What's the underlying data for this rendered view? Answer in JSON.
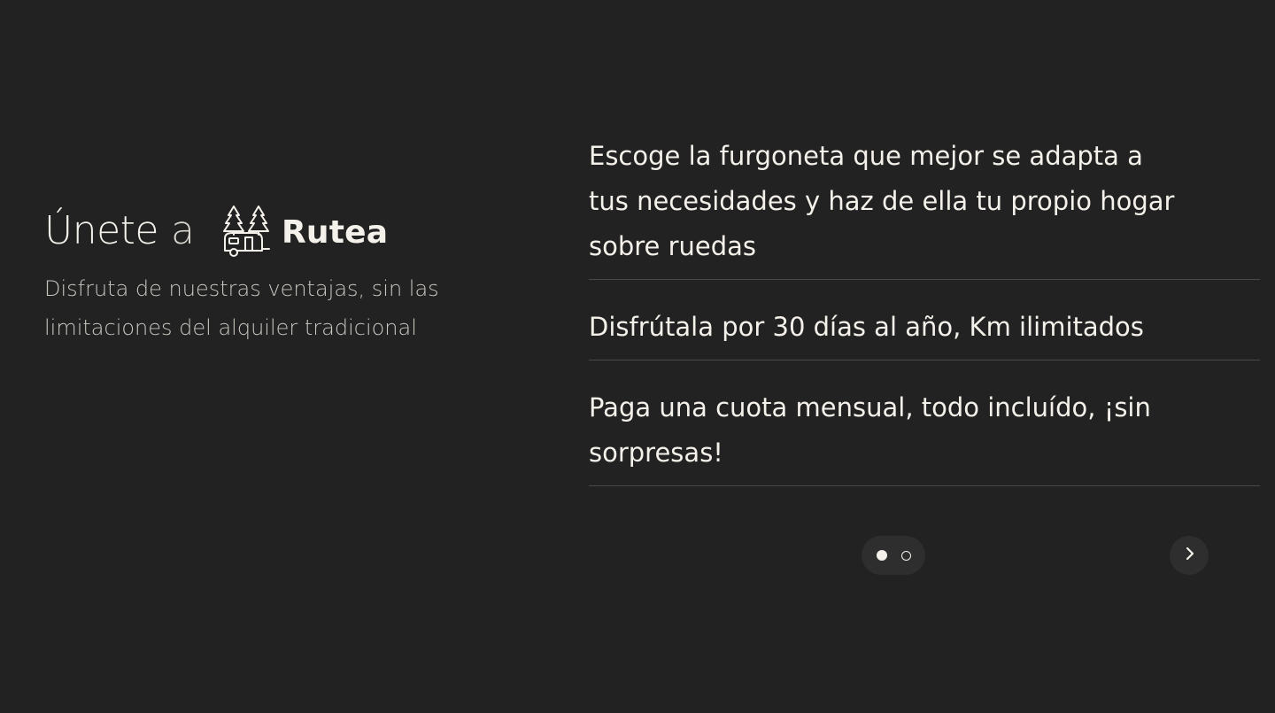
{
  "intro": {
    "heading": "Únete",
    "heading_connector": "a",
    "brand_name": "Rutea",
    "logo_icon": "trees-caravan-icon",
    "subtitle": "Disfruta de nuestras ventajas, sin las limitaciones del alquiler tradicional"
  },
  "benefits": [
    {
      "text": "Escoge la furgoneta que mejor se adapta a tus necesidades y haz de ella tu propio hogar sobre ruedas"
    },
    {
      "text": "Disfrútala por 30 días al año, Km ilimitados"
    },
    {
      "text": "Paga una cuota mensual, todo incluído, ¡sin sorpresas!"
    }
  ],
  "carousel": {
    "total_slides": 2,
    "active_slide": 1,
    "next_icon": "chevron-right-icon"
  },
  "colors": {
    "background": "#222222",
    "text": "#f4f1ea",
    "muted_text": "#c9c6c0",
    "divider": "#4a4a4a",
    "control_bg": "#2e2e2e"
  }
}
